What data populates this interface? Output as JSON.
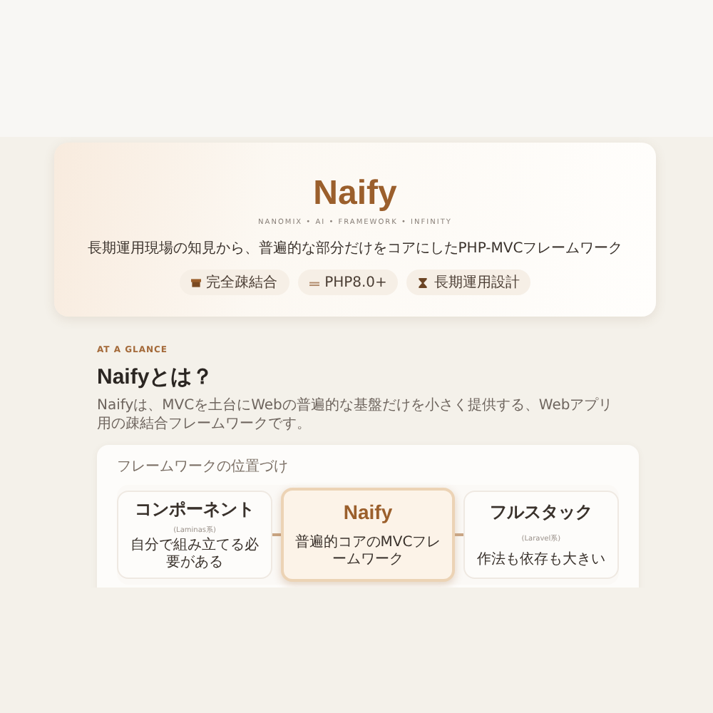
{
  "hero": {
    "logo": "Naify",
    "tagline": "NANOMIX • AI • FRAMEWORK • INFINITY",
    "subtitle": "長期運用現場の知見から、普遍的な部分だけをコアにしたPHP-MVCフレームワーク",
    "badges": [
      {
        "kind": "box",
        "label": "完全疎結合"
      },
      {
        "kind": "code",
        "label": "PHP8.0+"
      },
      {
        "kind": "hourglass",
        "label": "長期運用設計"
      }
    ]
  },
  "section": {
    "eyebrow": "AT A GLANCE",
    "title": "Naifyとは？",
    "description": "Naifyは、MVCを土台にWebの普遍的な基盤だけを小さく提供する、Webアプリ用の疎結合フレームワークです。",
    "diagram": {
      "caption": "フレームワークの位置づけ",
      "nodes": [
        {
          "title": "コンポーネント",
          "sub": "(Laminas系)",
          "note": "自分で組み立てる必要がある",
          "selected": false
        },
        {
          "title": "Naify",
          "note": "普遍的コアのMVCフレームワーク",
          "selected": true
        },
        {
          "title": "フルスタック",
          "sub": "(Laravel系)",
          "note": "作法も依存も大きい",
          "selected": false
        }
      ]
    }
  }
}
